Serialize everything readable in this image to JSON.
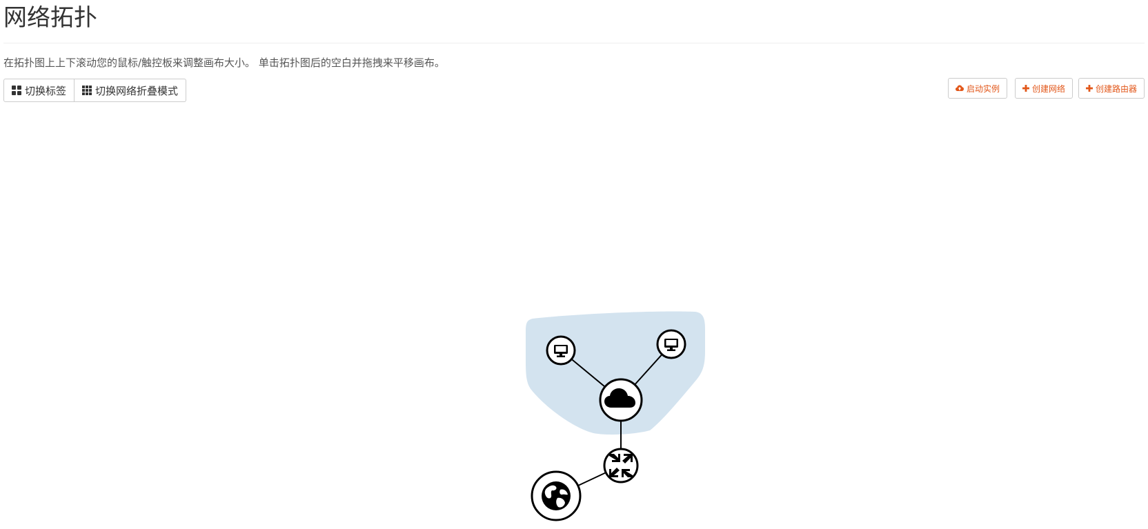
{
  "header": {
    "title": "网络拓扑"
  },
  "help": {
    "text": "在拓扑图上上下滚动您的鼠标/触控板来调整画布大小。 单击拓扑图后的空白并拖拽来平移画布。"
  },
  "toolbar": {
    "toggle_labels": "切换标签",
    "toggle_collapse": "切换网络折叠模式"
  },
  "actions": {
    "launch_instance": "启动实例",
    "create_network": "创建网络",
    "create_router": "创建路由器"
  },
  "colors": {
    "accent": "#e2571a",
    "network_group": "#d3e3ef",
    "node_stroke": "#000000"
  },
  "topology": {
    "nodes": [
      {
        "type": "instance",
        "icon": "monitor-icon"
      },
      {
        "type": "instance",
        "icon": "monitor-icon"
      },
      {
        "type": "network",
        "icon": "cloud-icon"
      },
      {
        "type": "router",
        "icon": "router-arrows-icon"
      },
      {
        "type": "external-network",
        "icon": "globe-icon"
      }
    ]
  }
}
